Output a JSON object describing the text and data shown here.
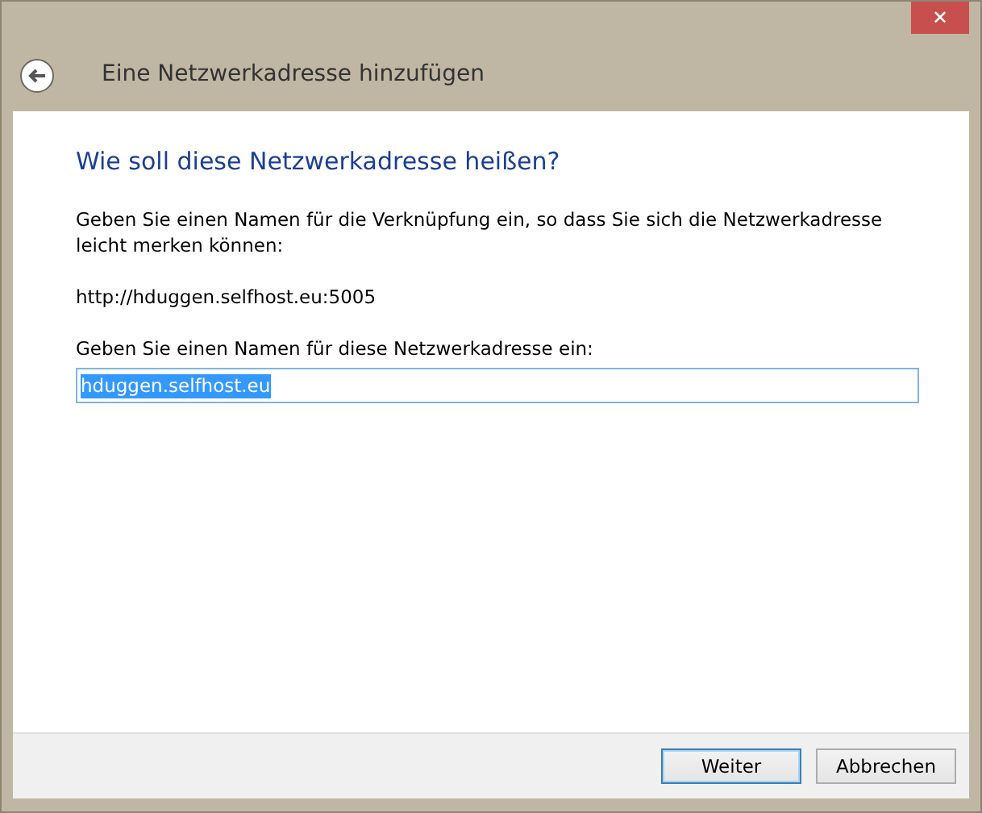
{
  "window": {
    "close_label": "✕"
  },
  "header": {
    "title": "Eine Netzwerkadresse hinzufügen"
  },
  "heading": "Wie soll diese Netzwerkadresse heißen?",
  "description": "Geben Sie einen Namen für die Verknüpfung ein, so dass Sie sich die Netzwerkadresse leicht merken können:",
  "address": "http://hduggen.selfhost.eu:5005",
  "name_field": {
    "label": "Geben Sie einen Namen für diese Netzwerkadresse ein:",
    "value": "hduggen.selfhost.eu",
    "value_selected": true
  },
  "buttons": [
    {
      "label": "Weiter",
      "default": true
    },
    {
      "label": "Abbrechen",
      "default": false
    }
  ]
}
